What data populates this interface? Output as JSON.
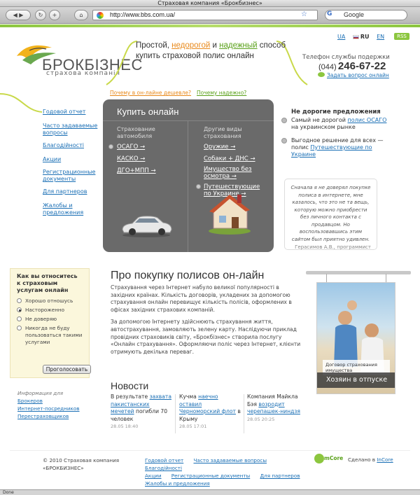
{
  "browser": {
    "title": "Страховая компания «Брокбизнес»",
    "url": "http://www.bbs.com.ua/",
    "search_placeholder": "Google",
    "status": "Done"
  },
  "header": {
    "logo_name": "БРОКБІЗНЕС",
    "logo_sub": "страхова компанія",
    "tagline_1": "Простой, ",
    "tagline_cheap": "недорогой",
    "tagline_2": " и ",
    "tagline_reliable": "надежный",
    "tagline_3": " способ купить страховой полис онлайн",
    "lang": [
      "UA",
      "RU",
      "EN"
    ],
    "rss": "RSS",
    "phone_label": "Телефон службы подержки",
    "phone_code": "(044)",
    "phone_number": "246-67-22",
    "ask": "Задать вопрос онлайн"
  },
  "top_links": {
    "why_cheaper": "Почему в он-лайне дешевле?",
    "why_reliable": "Почему надежно?"
  },
  "nav": [
    "Годовой отчет",
    "Часто задаваемые вопросы",
    "Благодійності",
    "Акции",
    "Регистрационные документы",
    "Для партнеров",
    "Жалобы и предложения"
  ],
  "buy": {
    "title": "Купить онлайн",
    "col1_heading": "Страхование автомобиля",
    "col1": [
      "ОСАГО →",
      "КАСКО →",
      "ДГО+МПП →"
    ],
    "col2_heading": "Другие виды страхования",
    "col2": [
      "Оружие →",
      "Собаки + ДНС →",
      "Имущество без осмотра →",
      "Путешествующие по Украине →"
    ]
  },
  "offers": {
    "title": "Не дорогие предложения",
    "o1_pre": "Самый не дорогой ",
    "o1_link": "полис ОСАГО",
    "o1_post": " на украинском рынке",
    "o2_pre": "Выгодное решение для всех — полис ",
    "o2_link": "Путешествующие по Украине"
  },
  "quote": {
    "text": "Сначала я не доверял покупке полиса в интернете, мне казалось, что это не та вещь, которую можно приобрести без личного контакта с продавцом. Но воспользовавшись этим сайтом был приятно удивлен.",
    "author": "Герасимов А.В., программист"
  },
  "poll": {
    "question": "Как вы относитесь к страховым услугам онлайн",
    "options": [
      "Хорошо отношусь",
      "Настороженно",
      "Не доверяю",
      "Никогда не буду пользоваться такими услугами"
    ],
    "vote": "Проголосовать"
  },
  "info": {
    "label": "Информация для",
    "links": [
      "Брокеров",
      "Интернет-посредников",
      "Перестраховщиков"
    ]
  },
  "article": {
    "title": "Про покупку полисов он-лайн",
    "p1": "Страхування через Інтернет набуло великої популярності в західних країнах. Кількість договорів, укладених за допомогою страхування онлайн перевищує кількість полісів, оформлених в офісах західних страхових компаній.",
    "p2": "За допомогою Інтернету здійснюють страхування життя, автострахування, замовляють зелену карту. Наслідуючи приклад провідних страховиків світу, «Брокбізнес» створила послугу «Онлайн страхування». Оформляючи поліс через Інтернет, клієнти отримують декілька переваг."
  },
  "promo": {
    "caption": "Договор страхования имущества",
    "big": "Хозяин в отпуске"
  },
  "news": {
    "title": "Новости",
    "items": [
      {
        "pre": "В результате ",
        "link": "захвата пакистанских мечетей",
        "post": " погибли 70 человек",
        "date": "28.05 18:40"
      },
      {
        "pre": "Кучма ",
        "link": "наечно оставил Черноморский флот",
        "post": " в Крыму",
        "date": "28.05 17:01"
      },
      {
        "pre": "Компания Майкла Бэя ",
        "link": "возродит черепашек-ниндзя",
        "post": "",
        "date": "28.05 20:25"
      }
    ]
  },
  "footer": {
    "copy_1": "© 2010 Страховая компания",
    "copy_2": "«БРОКБИЗНЕС»",
    "links": [
      "Годовой отчет",
      "Часто задаваемые вопросы",
      "Благодійності",
      "Акции",
      "Регистрационные документы",
      "Для партнеров",
      "Жалобы и предложения"
    ],
    "mcore": "mCore",
    "made_pre": "Сделано в ",
    "made_link": "InCore"
  },
  "colors": {
    "accent_green": "#8cc63f",
    "accent_orange": "#e8891b",
    "link": "#1a6fb5",
    "panel": "#6a6a6a"
  }
}
